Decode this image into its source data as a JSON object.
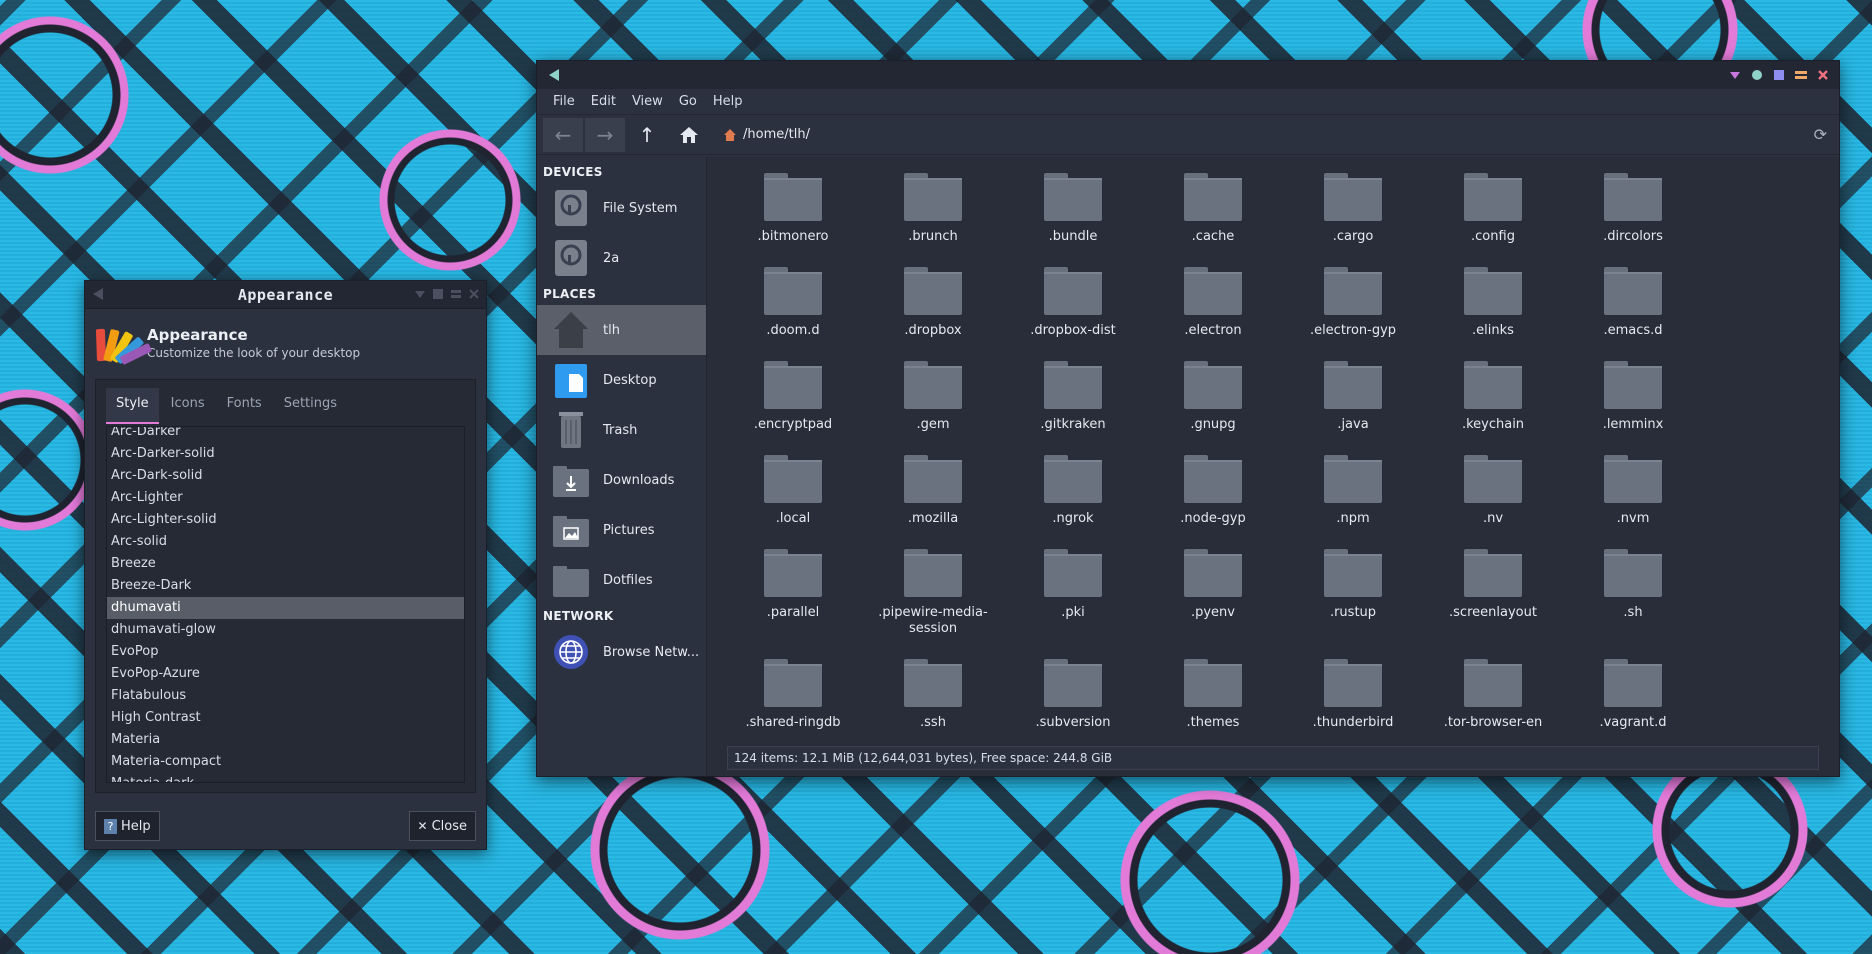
{
  "appearance_dialog": {
    "title": "Appearance",
    "header_title": "Appearance",
    "header_subtitle": "Customize the look of your desktop",
    "tabs": [
      "Style",
      "Icons",
      "Fonts",
      "Settings"
    ],
    "active_tab": "Style",
    "styles": [
      "Arc-Darker",
      "Arc-Darker-solid",
      "Arc-Dark-solid",
      "Arc-Lighter",
      "Arc-Lighter-solid",
      "Arc-solid",
      "Breeze",
      "Breeze-Dark",
      "dhumavati",
      "dhumavati-glow",
      "EvoPop",
      "EvoPop-Azure",
      "Flatabulous",
      "High Contrast",
      "Materia",
      "Materia-compact",
      "Materia-dark"
    ],
    "selected_style": "dhumavati",
    "help_label": "Help",
    "close_label": "Close"
  },
  "file_manager": {
    "menu": [
      "File",
      "Edit",
      "View",
      "Go",
      "Help"
    ],
    "path": "/home/tlh/",
    "sidebar": {
      "devices_heading": "DEVICES",
      "devices": [
        "File System",
        "2a"
      ],
      "places_heading": "PLACES",
      "places": [
        "tlh",
        "Desktop",
        "Trash",
        "Downloads",
        "Pictures",
        "Dotfiles"
      ],
      "network_heading": "NETWORK",
      "network": [
        "Browse Netw..."
      ]
    },
    "files": [
      ".bitmonero",
      ".brunch",
      ".bundle",
      ".cache",
      ".cargo",
      ".config",
      ".dircolors",
      ".doom.d",
      ".dropbox",
      ".dropbox-dist",
      ".electron",
      ".electron-gyp",
      ".elinks",
      ".emacs.d",
      ".encryptpad",
      ".gem",
      ".gitkraken",
      ".gnupg",
      ".java",
      ".keychain",
      ".lemminx",
      ".local",
      ".mozilla",
      ".ngrok",
      ".node-gyp",
      ".npm",
      ".nv",
      ".nvm",
      ".parallel",
      ".pipewire-media-session",
      ".pki",
      ".pyenv",
      ".rustup",
      ".screenlayout",
      ".sh",
      ".shared-ringdb",
      ".ssh",
      ".subversion",
      ".themes",
      ".thunderbird",
      ".tor-browser-en",
      ".vagrant.d"
    ],
    "status": "124 items: 12.1 MiB (12,644,031 bytes), Free space: 244.8 GiB"
  },
  "colors": {
    "accent_pink": "#e27ad8",
    "accent_cyan": "#27b7e0",
    "window_bg": "#2c3140",
    "folder_gray": "#6a727f"
  }
}
